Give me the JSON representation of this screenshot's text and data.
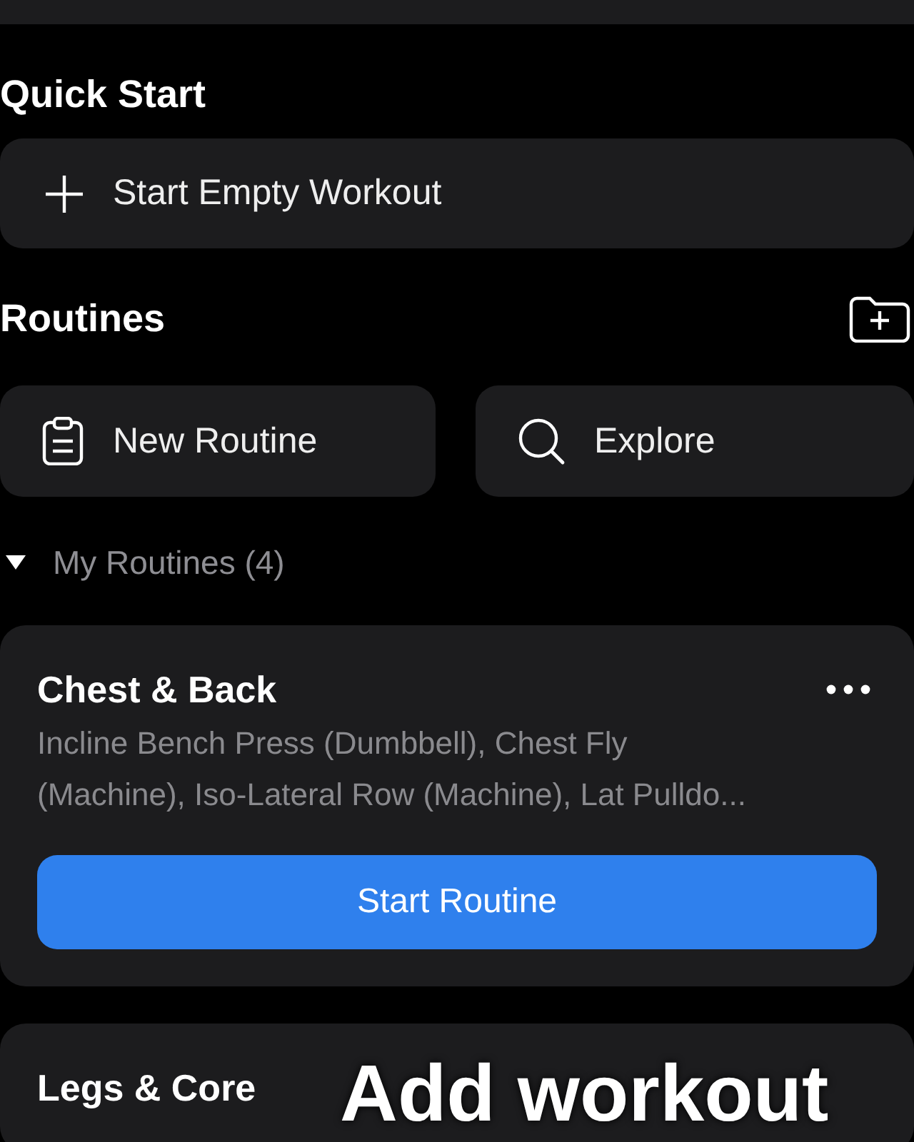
{
  "quick_start": {
    "title": "Quick Start",
    "action": {
      "label": "Start Empty Workout"
    }
  },
  "routines": {
    "title": "Routines",
    "actions": [
      {
        "label": "New Routine"
      },
      {
        "label": "Explore"
      }
    ],
    "group": {
      "label": "My Routines (4)",
      "expanded": true
    },
    "items": [
      {
        "name": "Chest & Back",
        "description": "Incline Bench Press (Dumbbell), Chest Fly (Machine), Iso-Lateral Row (Machine), Lat Pulldo...",
        "button": "Start Routine"
      },
      {
        "name": "Legs & Core"
      }
    ]
  },
  "caption": "Add workout"
}
